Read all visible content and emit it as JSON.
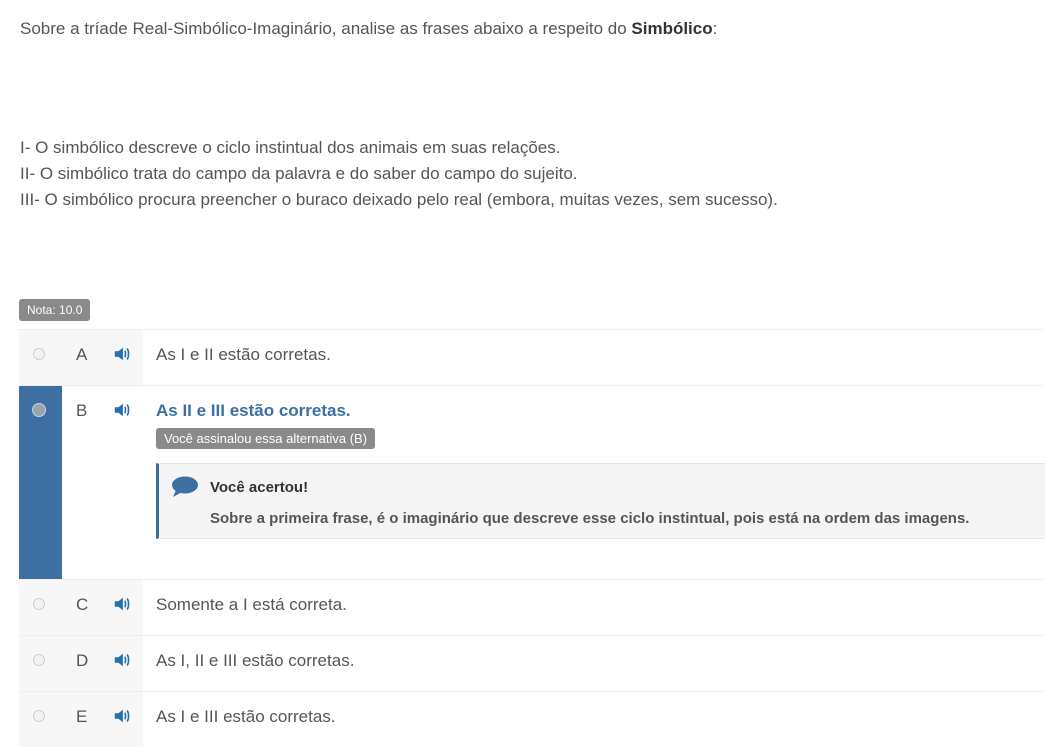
{
  "question": {
    "intro_prefix": "Sobre a tríade Real-Simbólico-Imaginário, analise as frases abaixo a respeito do ",
    "intro_bold": "Simbólico",
    "intro_suffix": ":",
    "statements": [
      "I- O simbólico descreve o ciclo instintual dos animais em suas relações.",
      "II- O simbólico trata do campo da palavra e do saber do campo do sujeito.",
      "III- O simbólico procura preencher o buraco deixado pelo real (embora, muitas vezes, sem sucesso)."
    ]
  },
  "grade": {
    "label": "Nota: 10.0"
  },
  "options": [
    {
      "letter": "A",
      "text": "As I e II estão corretas."
    },
    {
      "letter": "B",
      "text": "As II e III estão corretas."
    },
    {
      "letter": "C",
      "text": "Somente a I está correta."
    },
    {
      "letter": "D",
      "text": "As I, II e III estão corretas."
    },
    {
      "letter": "E",
      "text": "As I e III estão corretas."
    }
  ],
  "selected_option": "B",
  "selected_badge": "Você assinalou essa alternativa (B)",
  "feedback": {
    "title": "Você acertou!",
    "body": "Sobre a primeira frase, é o imaginário que descreve esse ciclo instintual, pois está na ordem das imagens."
  },
  "icons": {
    "speaker": "speaker-icon",
    "comment": "comment-bubble-icon"
  },
  "colors": {
    "accent": "#3d6fa3",
    "speaker": "#2a6fb0",
    "badge": "#8a8a8a"
  }
}
